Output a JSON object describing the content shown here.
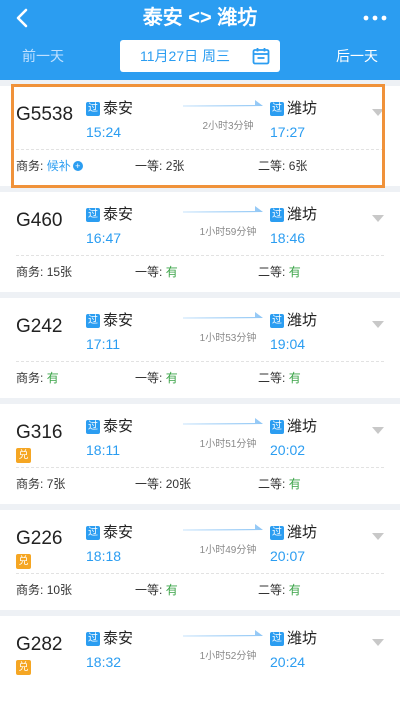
{
  "header": {
    "title": "泰安 <> 潍坊",
    "prev_day": "前一天",
    "next_day": "后一天",
    "date": "11月27日 周三"
  },
  "labels": {
    "business": "商务:",
    "first": "一等:",
    "second": "二等:",
    "pass_badge": "过",
    "exchange_badge": "兑"
  },
  "colors": {
    "primary": "#2b9df1",
    "available": "#3aa347",
    "highlight_border": "#f0923a",
    "exchange_badge": "#f5a623"
  },
  "trains": [
    {
      "no": "G5538",
      "from": "泰安",
      "dep": "15:24",
      "to": "潍坊",
      "arr": "17:27",
      "duration": "2小时3分钟",
      "business": "候补",
      "first": "2张",
      "second": "6张",
      "exchange": false,
      "highlighted": true
    },
    {
      "no": "G460",
      "from": "泰安",
      "dep": "16:47",
      "to": "潍坊",
      "arr": "18:46",
      "duration": "1小时59分钟",
      "business": "15张",
      "first": "有",
      "second": "有",
      "exchange": false,
      "highlighted": false
    },
    {
      "no": "G242",
      "from": "泰安",
      "dep": "17:11",
      "to": "潍坊",
      "arr": "19:04",
      "duration": "1小时53分钟",
      "business": "有",
      "first": "有",
      "second": "有",
      "exchange": false,
      "highlighted": false
    },
    {
      "no": "G316",
      "from": "泰安",
      "dep": "18:11",
      "to": "潍坊",
      "arr": "20:02",
      "duration": "1小时51分钟",
      "business": "7张",
      "first": "20张",
      "second": "有",
      "exchange": true,
      "highlighted": false
    },
    {
      "no": "G226",
      "from": "泰安",
      "dep": "18:18",
      "to": "潍坊",
      "arr": "20:07",
      "duration": "1小时49分钟",
      "business": "10张",
      "first": "有",
      "second": "有",
      "exchange": true,
      "highlighted": false
    },
    {
      "no": "G282",
      "from": "泰安",
      "dep": "18:32",
      "to": "潍坊",
      "arr": "20:24",
      "duration": "1小时52分钟",
      "business": "",
      "first": "",
      "second": "",
      "exchange": true,
      "highlighted": false
    }
  ]
}
